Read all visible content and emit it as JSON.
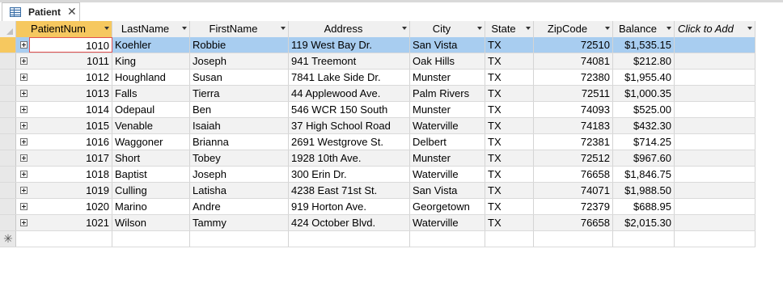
{
  "tab": {
    "label": "Patient",
    "close_glyph": "✕"
  },
  "columns": [
    {
      "key": "patient_num",
      "label": "PatientNum",
      "sorted": true
    },
    {
      "key": "last_name",
      "label": "LastName"
    },
    {
      "key": "first_name",
      "label": "FirstName"
    },
    {
      "key": "address",
      "label": "Address"
    },
    {
      "key": "city",
      "label": "City"
    },
    {
      "key": "state",
      "label": "State"
    },
    {
      "key": "zip",
      "label": "ZipCode"
    },
    {
      "key": "balance",
      "label": "Balance"
    },
    {
      "key": "add",
      "label": "Click to Add"
    }
  ],
  "rows": [
    {
      "patient_num": "1010",
      "last_name": "Koehler",
      "first_name": "Robbie",
      "address": "119 West Bay Dr.",
      "city": "San Vista",
      "state": "TX",
      "zip": "72510",
      "balance": "$1,535.15"
    },
    {
      "patient_num": "1011",
      "last_name": "King",
      "first_name": "Joseph",
      "address": "941 Treemont",
      "city": "Oak Hills",
      "state": "TX",
      "zip": "74081",
      "balance": "$212.80"
    },
    {
      "patient_num": "1012",
      "last_name": "Houghland",
      "first_name": "Susan",
      "address": "7841 Lake Side Dr.",
      "city": "Munster",
      "state": "TX",
      "zip": "72380",
      "balance": "$1,955.40"
    },
    {
      "patient_num": "1013",
      "last_name": "Falls",
      "first_name": "Tierra",
      "address": "44 Applewood Ave.",
      "city": "Palm Rivers",
      "state": "TX",
      "zip": "72511",
      "balance": "$1,000.35"
    },
    {
      "patient_num": "1014",
      "last_name": "Odepaul",
      "first_name": "Ben",
      "address": "546 WCR 150 South",
      "city": "Munster",
      "state": "TX",
      "zip": "74093",
      "balance": "$525.00"
    },
    {
      "patient_num": "1015",
      "last_name": "Venable",
      "first_name": "Isaiah",
      "address": "37 High School Road",
      "city": "Waterville",
      "state": "TX",
      "zip": "74183",
      "balance": "$432.30"
    },
    {
      "patient_num": "1016",
      "last_name": "Waggoner",
      "first_name": "Brianna",
      "address": "2691 Westgrove St.",
      "city": "Delbert",
      "state": "TX",
      "zip": "72381",
      "balance": "$714.25"
    },
    {
      "patient_num": "1017",
      "last_name": "Short",
      "first_name": "Tobey",
      "address": "1928 10th Ave.",
      "city": "Munster",
      "state": "TX",
      "zip": "72512",
      "balance": "$967.60"
    },
    {
      "patient_num": "1018",
      "last_name": "Baptist",
      "first_name": "Joseph",
      "address": "300 Erin Dr.",
      "city": "Waterville",
      "state": "TX",
      "zip": "76658",
      "balance": "$1,846.75"
    },
    {
      "patient_num": "1019",
      "last_name": "Culling",
      "first_name": "Latisha",
      "address": "4238 East 71st St.",
      "city": "San Vista",
      "state": "TX",
      "zip": "74071",
      "balance": "$1,988.50"
    },
    {
      "patient_num": "1020",
      "last_name": "Marino",
      "first_name": "Andre",
      "address": "919 Horton Ave.",
      "city": "Georgetown",
      "state": "TX",
      "zip": "72379",
      "balance": "$688.95"
    },
    {
      "patient_num": "1021",
      "last_name": "Wilson",
      "first_name": "Tammy",
      "address": "424 October Blvd.",
      "city": "Waterville",
      "state": "TX",
      "zip": "76658",
      "balance": "$2,015.30"
    }
  ],
  "new_record_glyph": "✳",
  "colors": {
    "selected_row": "#a8cdf0",
    "sorted_header": "#f6c85f",
    "alt_row": "#f2f2f2"
  }
}
